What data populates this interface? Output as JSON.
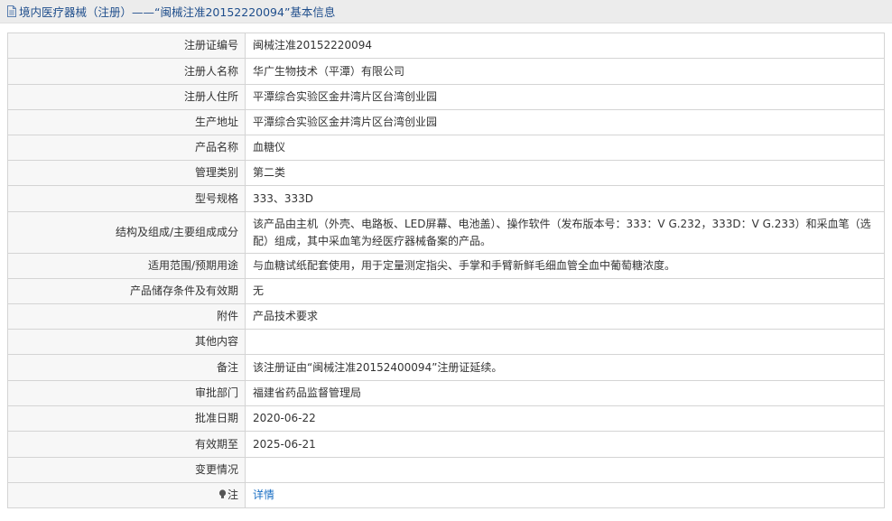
{
  "page_title": "境内医疗器械（注册）——“闽械注准20152220094”基本信息",
  "rows": [
    {
      "label": "注册证编号",
      "value": "闽械注准20152220094"
    },
    {
      "label": "注册人名称",
      "value": "华广生物技术（平潭）有限公司"
    },
    {
      "label": "注册人住所",
      "value": "平潭综合实验区金井湾片区台湾创业园"
    },
    {
      "label": "生产地址",
      "value": "平潭综合实验区金井湾片区台湾创业园"
    },
    {
      "label": "产品名称",
      "value": "血糖仪"
    },
    {
      "label": "管理类别",
      "value": "第二类"
    },
    {
      "label": "型号规格",
      "value": "333、333D"
    },
    {
      "label": "结构及组成/主要组成成分",
      "value": "该产品由主机（外壳、电路板、LED屏幕、电池盖）、操作软件（发布版本号：333：V G.232，333D：V G.233）和采血笔（选配）组成，其中采血笔为经医疗器械备案的产品。"
    },
    {
      "label": "适用范围/预期用途",
      "value": "与血糖试纸配套使用，用于定量测定指尖、手掌和手臂新鲜毛细血管全血中葡萄糖浓度。"
    },
    {
      "label": "产品储存条件及有效期",
      "value": "无"
    },
    {
      "label": "附件",
      "value": "产品技术要求"
    },
    {
      "label": "其他内容",
      "value": ""
    },
    {
      "label": "备注",
      "value": "该注册证由“闽械注准20152400094”注册证延续。"
    },
    {
      "label": "审批部门",
      "value": "福建省药品监督管理局"
    },
    {
      "label": "批准日期",
      "value": "2020-06-22"
    },
    {
      "label": "有效期至",
      "value": "2025-06-21"
    },
    {
      "label": "变更情况",
      "value": ""
    }
  ],
  "note_row": {
    "label": "注",
    "icon": "lightbulb-icon",
    "link": "详情"
  }
}
